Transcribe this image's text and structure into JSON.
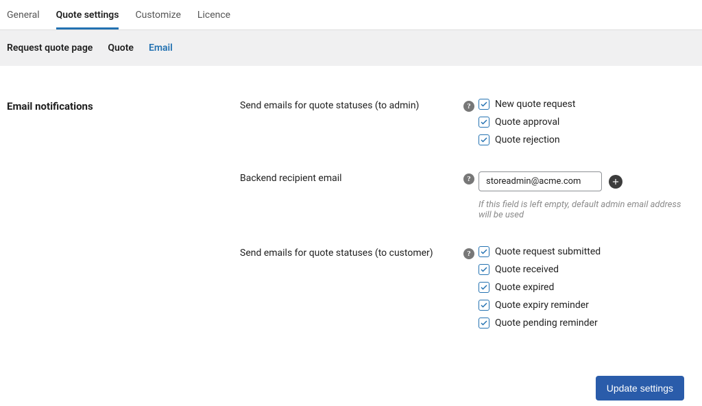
{
  "topTabs": {
    "items": [
      {
        "label": "General"
      },
      {
        "label": "Quote settings"
      },
      {
        "label": "Customize"
      },
      {
        "label": "Licence"
      }
    ],
    "activeIndex": 1
  },
  "subNav": {
    "items": [
      {
        "label": "Request quote page"
      },
      {
        "label": "Quote"
      },
      {
        "label": "Email"
      }
    ],
    "activeIndex": 2
  },
  "section": {
    "title": "Email notifications",
    "rows": {
      "admin": {
        "label": "Send emails for quote statuses (to admin)",
        "options": [
          {
            "label": "New quote request",
            "checked": true
          },
          {
            "label": "Quote approval",
            "checked": true
          },
          {
            "label": "Quote rejection",
            "checked": true
          }
        ]
      },
      "email": {
        "label": "Backend recipient email",
        "value": "storeadmin@acme.com",
        "hint": "If this field is left empty, default admin email address will be used"
      },
      "customer": {
        "label": "Send emails for quote statuses (to customer)",
        "options": [
          {
            "label": "Quote request submitted",
            "checked": true
          },
          {
            "label": "Quote received",
            "checked": true
          },
          {
            "label": "Quote expired",
            "checked": true
          },
          {
            "label": "Quote expiry reminder",
            "checked": true
          },
          {
            "label": "Quote pending reminder",
            "checked": true
          }
        ]
      }
    }
  },
  "saveButton": {
    "label": "Update settings"
  }
}
